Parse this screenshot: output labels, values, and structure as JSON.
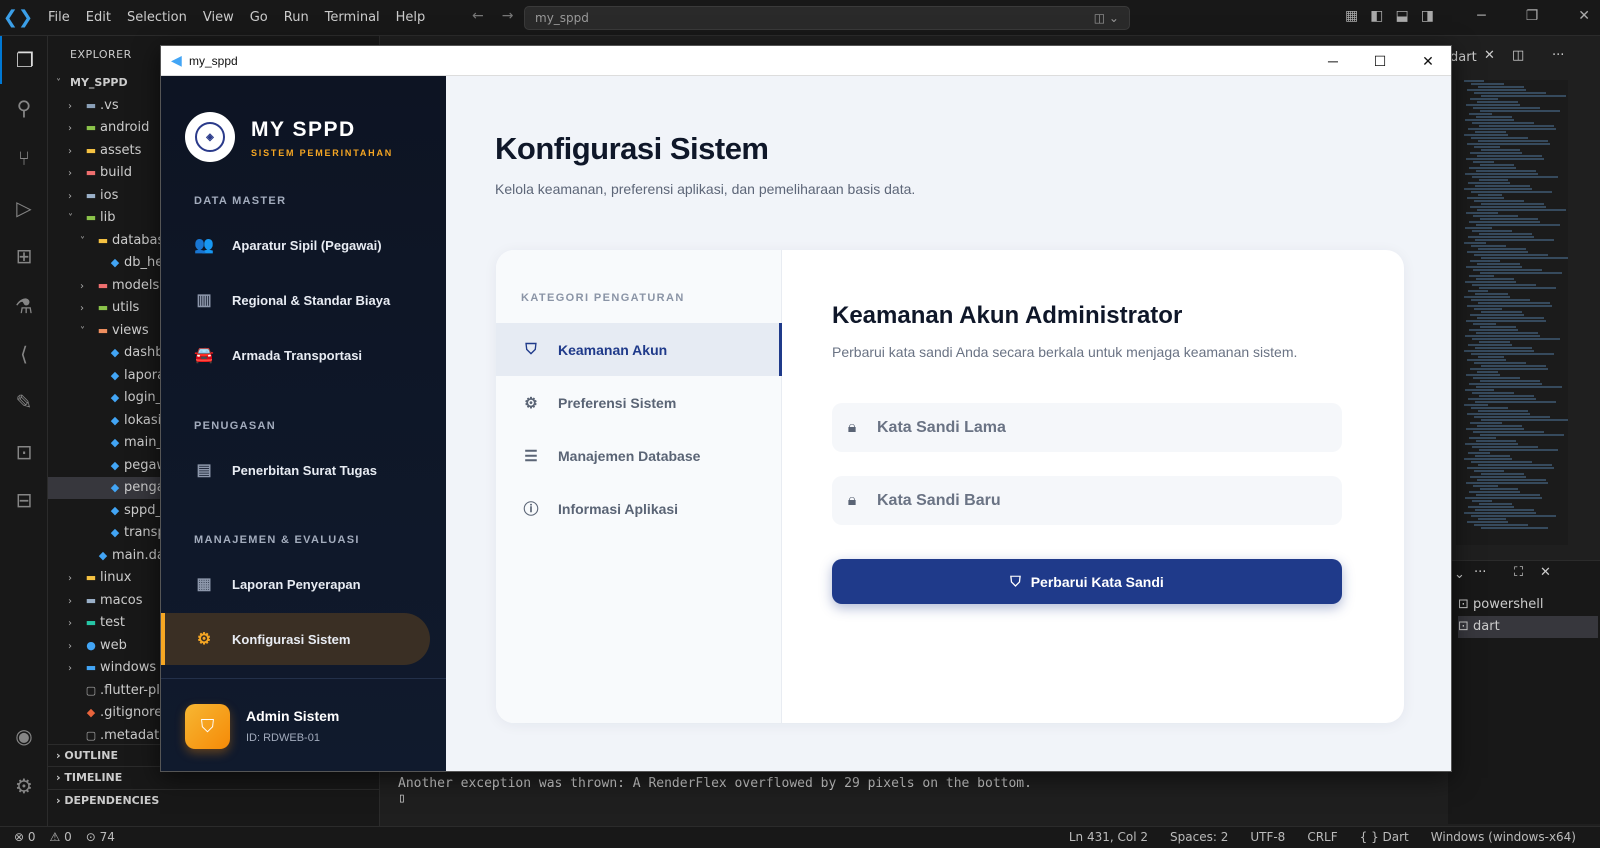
{
  "vscode": {
    "menu": [
      "File",
      "Edit",
      "Selection",
      "View",
      "Go",
      "Run",
      "Terminal",
      "Help"
    ],
    "search_text": "my_sppd",
    "explorer_title": "EXPLORER",
    "tree": [
      {
        "label": "MY_SPPD",
        "indent": 0,
        "chev": "˅",
        "icon": ""
      },
      {
        "label": ".vs",
        "indent": 1,
        "chev": "›",
        "icon": "▬",
        "color": "#8aa0b8"
      },
      {
        "label": "android",
        "indent": 1,
        "chev": "›",
        "icon": "▬",
        "color": "#8bc34a"
      },
      {
        "label": "assets",
        "indent": 1,
        "chev": "›",
        "icon": "▬",
        "color": "#f5c242"
      },
      {
        "label": "build",
        "indent": 1,
        "chev": "›",
        "icon": "▬",
        "color": "#ef6f6f"
      },
      {
        "label": "ios",
        "indent": 1,
        "chev": "›",
        "icon": "▬",
        "color": "#9ab0c8"
      },
      {
        "label": "lib",
        "indent": 1,
        "chev": "˅",
        "icon": "▬",
        "color": "#8bc34a"
      },
      {
        "label": "database",
        "indent": 2,
        "chev": "˅",
        "icon": "▬",
        "color": "#f5c242"
      },
      {
        "label": "db_help",
        "indent": 3,
        "chev": "",
        "icon": "◆",
        "color": "#42a5f5"
      },
      {
        "label": "models",
        "indent": 2,
        "chev": "›",
        "icon": "▬",
        "color": "#ef6f6f"
      },
      {
        "label": "utils",
        "indent": 2,
        "chev": "›",
        "icon": "▬",
        "color": "#8bc34a"
      },
      {
        "label": "views",
        "indent": 2,
        "chev": "˅",
        "icon": "▬",
        "color": "#ef8f5f"
      },
      {
        "label": "dashbo",
        "indent": 3,
        "chev": "",
        "icon": "◆",
        "color": "#42a5f5"
      },
      {
        "label": "laporan",
        "indent": 3,
        "chev": "",
        "icon": "◆",
        "color": "#42a5f5"
      },
      {
        "label": "login_s",
        "indent": 3,
        "chev": "",
        "icon": "◆",
        "color": "#42a5f5"
      },
      {
        "label": "lokasi_",
        "indent": 3,
        "chev": "",
        "icon": "◆",
        "color": "#42a5f5"
      },
      {
        "label": "main_la",
        "indent": 3,
        "chev": "",
        "icon": "◆",
        "color": "#42a5f5"
      },
      {
        "label": "pegawa",
        "indent": 3,
        "chev": "",
        "icon": "◆",
        "color": "#42a5f5"
      },
      {
        "label": "pengat",
        "indent": 3,
        "chev": "",
        "icon": "◆",
        "color": "#42a5f5",
        "sel": true
      },
      {
        "label": "sppd_s",
        "indent": 3,
        "chev": "",
        "icon": "◆",
        "color": "#42a5f5"
      },
      {
        "label": "transpo",
        "indent": 3,
        "chev": "",
        "icon": "◆",
        "color": "#42a5f5"
      },
      {
        "label": "main.dar",
        "indent": 2,
        "chev": "",
        "icon": "◆",
        "color": "#42a5f5"
      },
      {
        "label": "linux",
        "indent": 1,
        "chev": "›",
        "icon": "▬",
        "color": "#f5c242"
      },
      {
        "label": "macos",
        "indent": 1,
        "chev": "›",
        "icon": "▬",
        "color": "#9ab0c8"
      },
      {
        "label": "test",
        "indent": 1,
        "chev": "›",
        "icon": "▬",
        "color": "#26c6a6"
      },
      {
        "label": "web",
        "indent": 1,
        "chev": "›",
        "icon": "●",
        "color": "#42a5f5"
      },
      {
        "label": "windows",
        "indent": 1,
        "chev": "›",
        "icon": "▬",
        "color": "#42a5f5"
      },
      {
        "label": ".flutter-plu",
        "indent": 1,
        "chev": "",
        "icon": "▢",
        "color": "#aaa"
      },
      {
        "label": ".gitignore",
        "indent": 1,
        "chev": "",
        "icon": "◆",
        "color": "#e8643c"
      },
      {
        "label": ".metadata",
        "indent": 1,
        "chev": "",
        "icon": "▢",
        "color": "#aaa"
      }
    ],
    "sections": [
      "OUTLINE",
      "TIMELINE",
      "DEPENDENCIES"
    ],
    "right_tab": "dart",
    "terminal_items": [
      "powershell",
      "dart"
    ],
    "terminal_output": "Another exception was thrown: A RenderFlex overflowed by 29 pixels on the bottom.",
    "status_left": [
      "⊗ 0",
      "⚠ 0",
      "⊙ 74"
    ],
    "status_right": [
      "Ln 431, Col 2",
      "Spaces: 2",
      "UTF-8",
      "CRLF",
      "{ } Dart",
      "Windows (windows-x64)"
    ]
  },
  "app": {
    "window_title": "my_sppd",
    "brand_name": "MY SPPD",
    "brand_sub": "SISTEM PEMERINTAHAN",
    "sections": [
      "DATA MASTER",
      "PENUGASAN",
      "MANAJEMEN & EVALUASI"
    ],
    "menu": [
      {
        "label": "Aparatur Sipil (Pegawai)",
        "icon": "people-icon"
      },
      {
        "label": "Regional & Standar Biaya",
        "icon": "map-icon"
      },
      {
        "label": "Armada Transportasi",
        "icon": "car-icon"
      },
      {
        "label": "Penerbitan Surat Tugas",
        "icon": "document-icon"
      },
      {
        "label": "Laporan Penyerapan",
        "icon": "chart-icon"
      },
      {
        "label": "Konfigurasi Sistem",
        "icon": "gear-icon",
        "active": true
      }
    ],
    "admin_name": "Admin Sistem",
    "admin_id": "ID: RDWEB-01",
    "page_title": "Konfigurasi Sistem",
    "page_subtitle": "Kelola keamanan, preferensi aplikasi, dan pemeliharaan basis data.",
    "category_title": "KATEGORI PENGATURAN",
    "categories": [
      {
        "label": "Keamanan Akun",
        "icon": "shield-icon",
        "active": true
      },
      {
        "label": "Preferensi Sistem",
        "icon": "cogs-icon"
      },
      {
        "label": "Manajemen Database",
        "icon": "database-icon"
      },
      {
        "label": "Informasi Aplikasi",
        "icon": "info-icon"
      }
    ],
    "section_title": "Keamanan Akun Administrator",
    "section_subtitle": "Perbarui kata sandi Anda secara berkala untuk menjaga keamanan sistem.",
    "old_password_placeholder": "Kata Sandi Lama",
    "new_password_placeholder": "Kata Sandi Baru",
    "update_button": "Perbarui Kata Sandi",
    "accent": "#f5a623",
    "primary": "#1f3a8a"
  }
}
